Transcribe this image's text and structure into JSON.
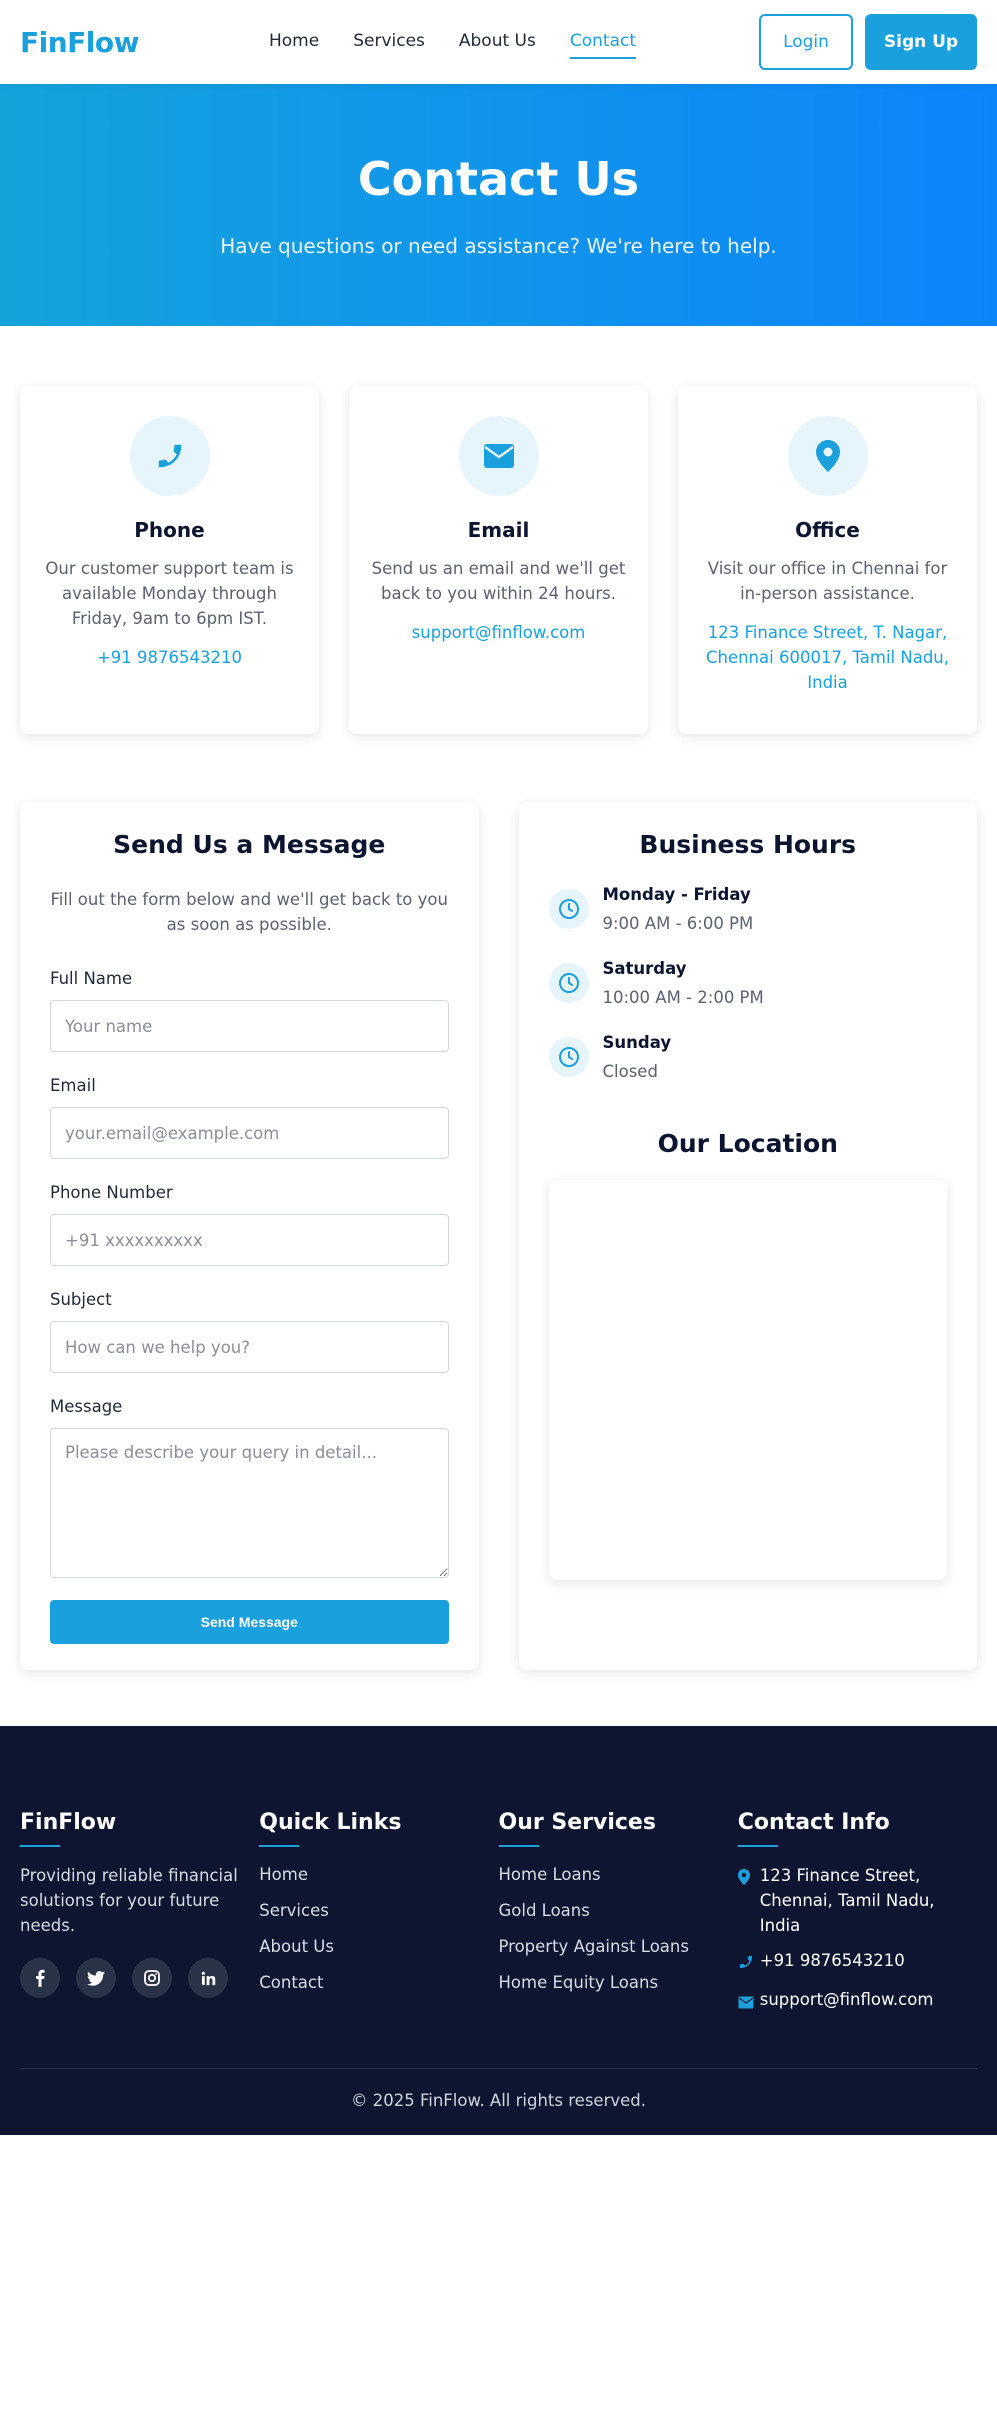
{
  "header": {
    "logo": "FinFlow",
    "nav": [
      "Home",
      "Services",
      "About Us",
      "Contact"
    ],
    "active_nav": "Contact",
    "login": "Login",
    "signup": "Sign Up"
  },
  "hero": {
    "title": "Contact Us",
    "subtitle": "Have questions or need assistance? We're here to help."
  },
  "cards": [
    {
      "icon": "phone-icon",
      "title": "Phone",
      "text": "Our customer support team is available Monday through Friday, 9am to 6pm IST.",
      "link": "+91 9876543210"
    },
    {
      "icon": "envelope-icon",
      "title": "Email",
      "text": "Send us an email and we'll get back to you within 24 hours.",
      "link": "support@finflow.com"
    },
    {
      "icon": "location-pin-icon",
      "title": "Office",
      "text": "Visit our office in Chennai for in-person assistance.",
      "link": "123 Finance Street, T. Nagar, Chennai 600017, Tamil Nadu, India"
    }
  ],
  "form": {
    "title": "Send Us a Message",
    "subtitle": "Fill out the form below and we'll get back to you as soon as possible.",
    "fields": {
      "full_name": {
        "label": "Full Name",
        "placeholder": "Your name"
      },
      "email": {
        "label": "Email",
        "placeholder": "your.email@example.com"
      },
      "phone": {
        "label": "Phone Number",
        "placeholder": "+91 xxxxxxxxxx"
      },
      "subject": {
        "label": "Subject",
        "placeholder": "How can we help you?"
      },
      "message": {
        "label": "Message",
        "placeholder": "Please describe your query in detail..."
      }
    },
    "submit": "Send Message"
  },
  "hours": {
    "title": "Business Hours",
    "rows": [
      {
        "day": "Monday - Friday",
        "time": "9:00 AM - 6:00 PM"
      },
      {
        "day": "Saturday",
        "time": "10:00 AM - 2:00 PM"
      },
      {
        "day": "Sunday",
        "time": "Closed"
      }
    ],
    "location_title": "Our Location"
  },
  "footer": {
    "brand": {
      "title": "FinFlow",
      "desc": "Providing reliable financial solutions for your future needs.",
      "social": [
        "f",
        "twitter",
        "instagram",
        "in"
      ]
    },
    "quick_links": {
      "title": "Quick Links",
      "items": [
        "Home",
        "Services",
        "About Us",
        "Contact"
      ]
    },
    "services": {
      "title": "Our Services",
      "items": [
        "Home Loans",
        "Gold Loans",
        "Property Against Loans",
        "Home Equity Loans"
      ]
    },
    "contact": {
      "title": "Contact Info",
      "address": "123 Finance Street, Chennai, Tamil Nadu, India",
      "phone": "+91 9876543210",
      "email": "support@finflow.com"
    },
    "copyright": "© 2025 FinFlow. All rights reserved."
  },
  "colors": {
    "accent": "#1aa0dc",
    "footer_bg": "#0d1530",
    "text_dark": "#0b1530"
  }
}
